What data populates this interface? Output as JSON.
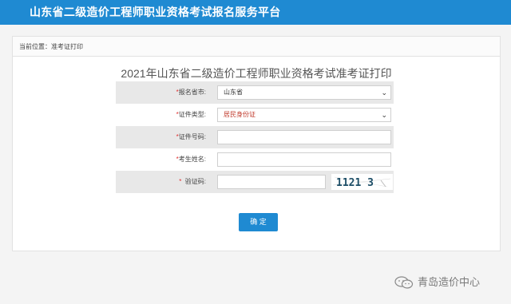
{
  "header": {
    "title": "山东省二级造价工程师职业资格考试报名服务平台"
  },
  "breadcrumb": {
    "text": "当前位置：准考证打印"
  },
  "form": {
    "title": "2021年山东省二级造价工程师职业资格考试准考证打印",
    "fields": [
      {
        "required_mark": "*",
        "label": "报名省市:",
        "type": "select",
        "value": "山东省"
      },
      {
        "required_mark": "*",
        "label": "证件类型:",
        "type": "select",
        "value": "居民身份证"
      },
      {
        "required_mark": "*",
        "label": "证件号码:",
        "type": "text",
        "value": ""
      },
      {
        "required_mark": "*",
        "label": "考生姓名:",
        "type": "text",
        "value": ""
      },
      {
        "required_mark": "*",
        "label": "验证码:",
        "type": "captcha",
        "value": "",
        "captcha_text": "1121 3"
      }
    ],
    "submit_label": "确 定"
  },
  "watermark": {
    "text": "青岛造价中心"
  },
  "colors": {
    "header_bg": "#1f8ad2",
    "button_bg": "#1f8ad2",
    "required_mark": "#e03030",
    "id_type_value": "#c0392b"
  }
}
